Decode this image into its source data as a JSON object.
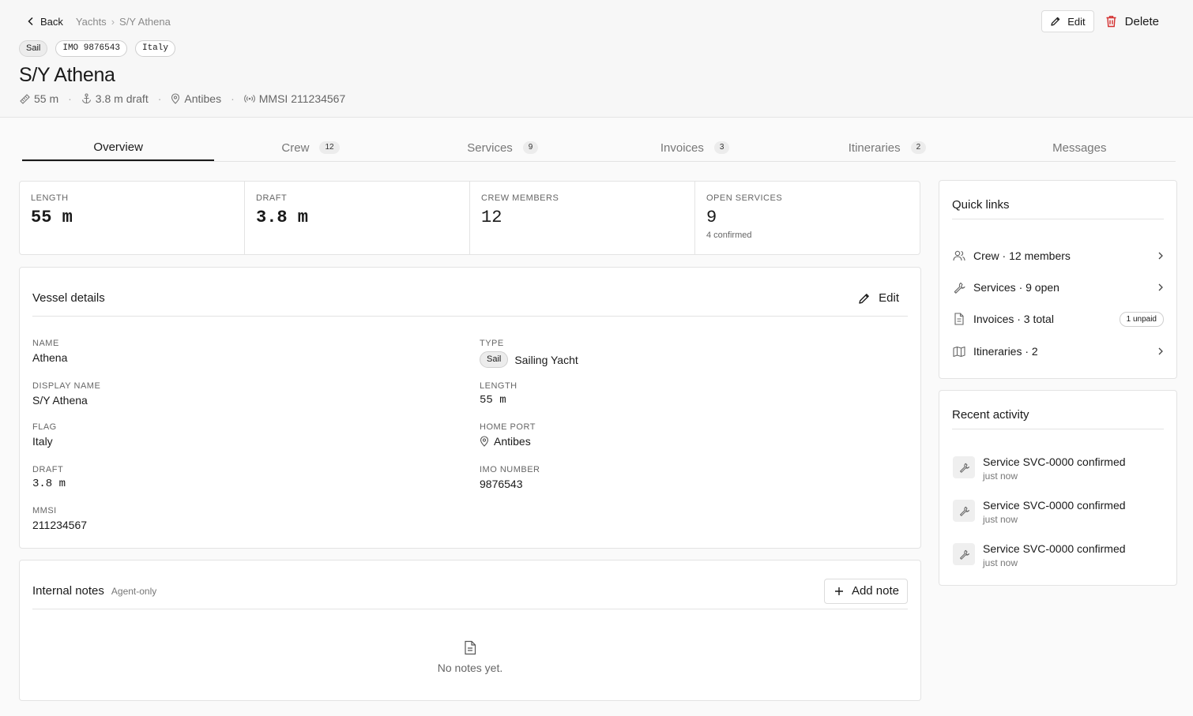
{
  "breadcrumb": {
    "back_label": "Back",
    "items": [
      "Yachts",
      "S/Y Athena"
    ]
  },
  "header_actions": {
    "edit_label": "Edit",
    "delete_label": "Delete"
  },
  "chips": [
    "Sail",
    "IMO 9876543",
    "Italy"
  ],
  "title": "S/Y Athena",
  "meta": {
    "length": "55 m",
    "draft": "3.8 m draft",
    "port": "Antibes",
    "mmsi": "MMSI 211234567"
  },
  "tabs": [
    {
      "label": "Overview",
      "count": ""
    },
    {
      "label": "Crew",
      "count": "12"
    },
    {
      "label": "Services",
      "count": "9"
    },
    {
      "label": "Invoices",
      "count": "3"
    },
    {
      "label": "Itineraries",
      "count": "2"
    },
    {
      "label": "Messages",
      "count": ""
    }
  ],
  "stats": [
    {
      "label": "LENGTH",
      "value": "55 m",
      "sub": ""
    },
    {
      "label": "DRAFT",
      "value": "3.8 m",
      "sub": ""
    },
    {
      "label": "CREW MEMBERS",
      "value": "12",
      "sub": ""
    },
    {
      "label": "OPEN SERVICES",
      "value": "9",
      "sub": "4 confirmed"
    }
  ],
  "vessel_details": {
    "title": "Vessel details",
    "edit_label": "Edit",
    "name_label": "NAME",
    "name": "Athena",
    "display_name_label": "DISPLAY NAME",
    "display_name": "S/Y Athena",
    "flag_label": "FLAG",
    "flag": "Italy",
    "draft_label": "DRAFT",
    "draft": "3.8 m",
    "mmsi_label": "MMSI",
    "mmsi": "211234567",
    "type_label": "TYPE",
    "type_tag": "Sail",
    "type": "Sailing Yacht",
    "length_label": "LENGTH",
    "length": "55 m",
    "home_port_label": "HOME PORT",
    "home_port": "Antibes",
    "imo_label": "IMO NUMBER",
    "imo": "9876543"
  },
  "notes": {
    "title": "Internal notes",
    "subtitle": "Agent-only",
    "add_label": "Add note",
    "empty_text": "No notes yet."
  },
  "quick_links": {
    "title": "Quick links",
    "items": [
      {
        "label": "Crew · 12 members",
        "icon": "users-icon",
        "badge": ""
      },
      {
        "label": "Services · 9 open",
        "icon": "wrench-icon",
        "badge": ""
      },
      {
        "label": "Invoices · 3 total",
        "icon": "file-icon",
        "badge": "1 unpaid"
      },
      {
        "label": "Itineraries · 2",
        "icon": "map-icon",
        "badge": ""
      }
    ]
  },
  "recent_activity": {
    "title": "Recent activity",
    "items": [
      {
        "text": "Service SVC-0000 confirmed",
        "time": "just now"
      },
      {
        "text": "Service SVC-0000 confirmed",
        "time": "just now"
      },
      {
        "text": "Service SVC-0000 confirmed",
        "time": "just now"
      }
    ]
  },
  "colors": {
    "delete": "#d32f2f",
    "active_tab": "#1a1a1a",
    "muted": "#777777"
  }
}
